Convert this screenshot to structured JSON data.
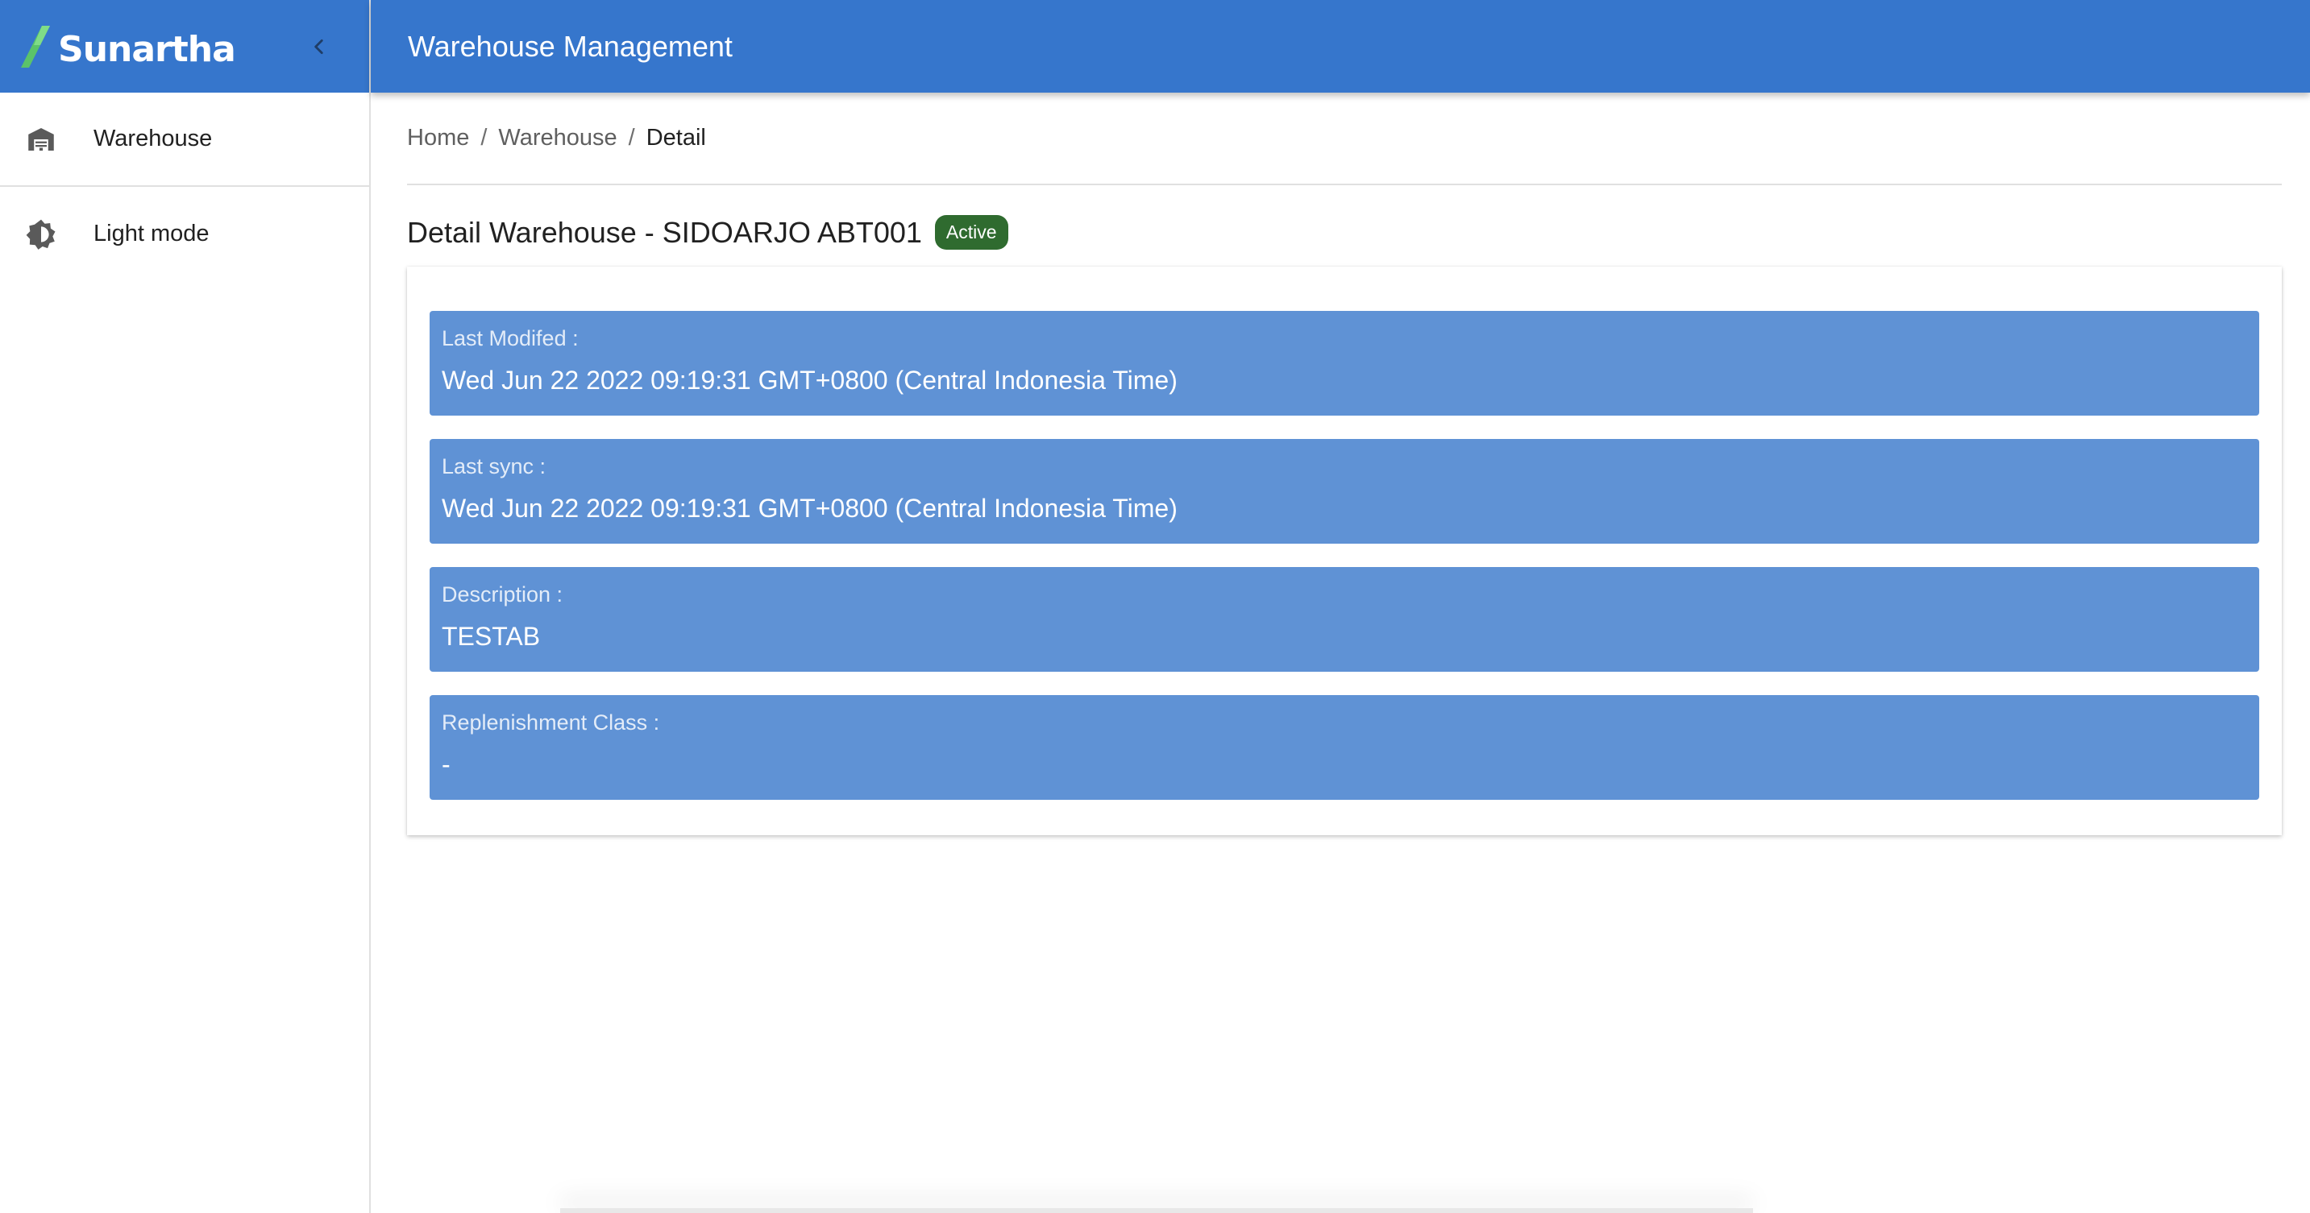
{
  "app": {
    "brand": "Sunartha",
    "colors": {
      "primary": "#3676cc",
      "field_bg": "#5f92d5",
      "badge_active": "#2f6b2f"
    }
  },
  "sidebar": {
    "collapse_icon": "chevron-left-icon",
    "items": [
      {
        "label": "Warehouse",
        "icon": "warehouse-icon"
      },
      {
        "label": "Light mode",
        "icon": "brightness-icon"
      }
    ]
  },
  "topbar": {
    "title": "Warehouse Management"
  },
  "breadcrumb": {
    "home": "Home",
    "sep1": "/",
    "warehouse": "Warehouse",
    "sep2": "/",
    "current": "Detail"
  },
  "detail": {
    "title": "Detail Warehouse - SIDOARJO ABT001",
    "status": "Active",
    "fields": [
      {
        "label": "Last Modifed :",
        "value": "Wed Jun 22 2022 09:19:31 GMT+0800 (Central Indonesia Time)"
      },
      {
        "label": "Last sync :",
        "value": "Wed Jun 22 2022 09:19:31 GMT+0800 (Central Indonesia Time)"
      },
      {
        "label": "Description :",
        "value": "TESTAB"
      },
      {
        "label": "Replenishment Class :",
        "value": "-"
      }
    ]
  }
}
